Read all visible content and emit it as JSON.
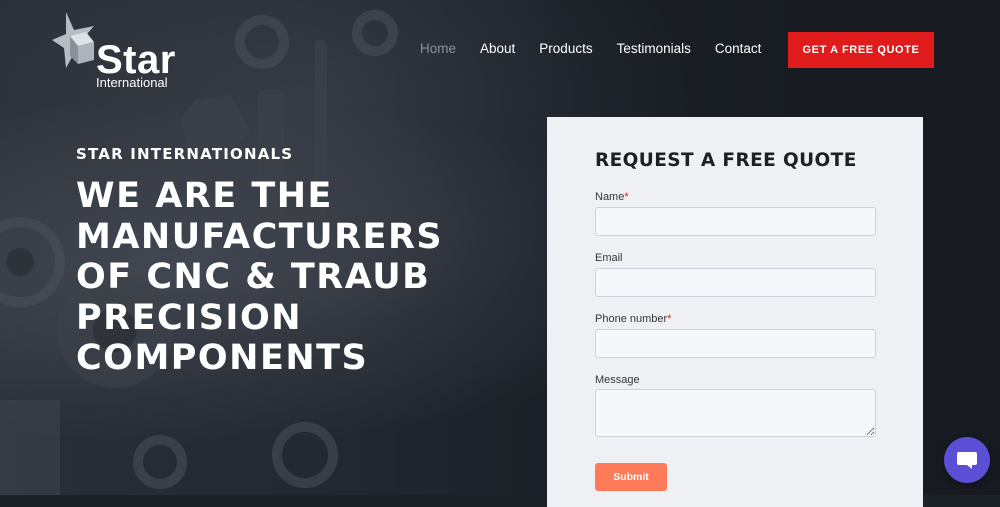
{
  "brand": {
    "logo_word": "Star",
    "logo_sub": "International",
    "logo_icon": "star-cube-icon"
  },
  "nav": {
    "items": [
      {
        "label": "Home",
        "active": true
      },
      {
        "label": "About",
        "active": false
      },
      {
        "label": "Products",
        "active": false
      },
      {
        "label": "Testimonials",
        "active": false
      },
      {
        "label": "Contact",
        "active": false
      }
    ],
    "cta_label": "GET A FREE QUOTE"
  },
  "hero": {
    "eyebrow": "STAR INTERNATIONALS",
    "headline_lines": [
      "WE ARE THE",
      "MANUFACTURERS",
      "OF CNC & TRAUB",
      "PRECISION",
      "COMPONENTS"
    ]
  },
  "form": {
    "title": "REQUEST A FREE QUOTE",
    "fields": {
      "name": {
        "label": "Name",
        "required_mark": "*",
        "value": ""
      },
      "email": {
        "label": "Email",
        "value": ""
      },
      "phone": {
        "label": "Phone number",
        "required_mark": "*",
        "value": ""
      },
      "message": {
        "label": "Message",
        "value": ""
      }
    },
    "submit_label": "Submit"
  },
  "chat": {
    "icon": "chat-bubble-icon"
  },
  "colors": {
    "accent_red": "#e01b1b",
    "submit_orange": "#ff7a59",
    "chat_purple": "#5b4fd6",
    "form_bg": "#eef0f4",
    "hero_bg": "#1d2128"
  }
}
